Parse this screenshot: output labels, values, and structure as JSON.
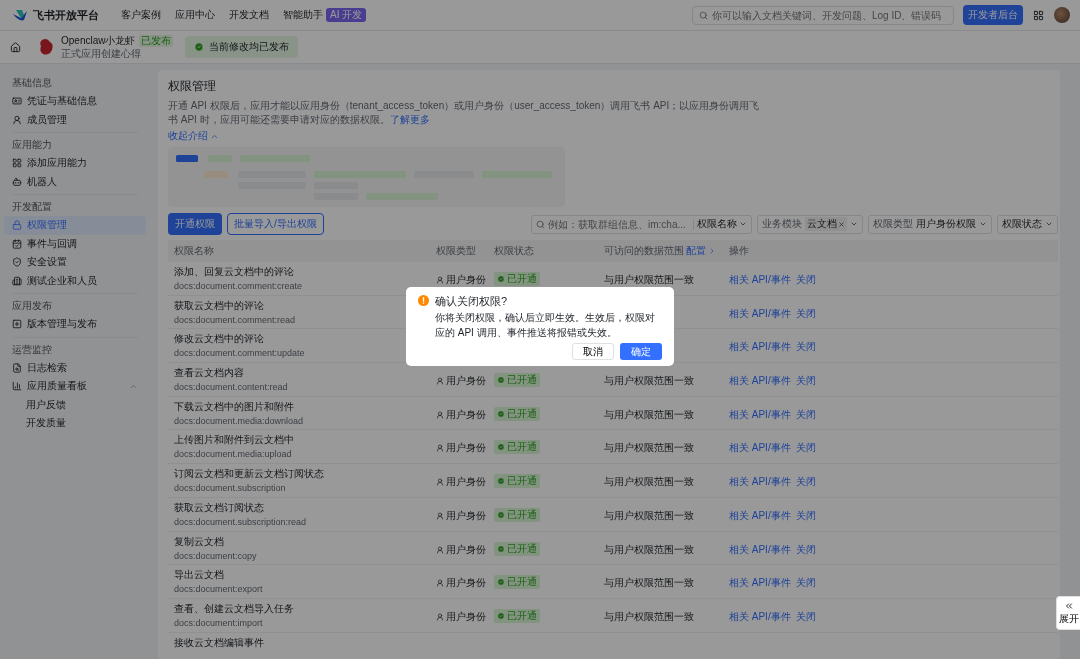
{
  "top_bar": {
    "brand": "飞书开放平台",
    "nav": [
      {
        "label": "客户案例"
      },
      {
        "label": "应用中心"
      },
      {
        "label": "开发文档"
      },
      {
        "label": "智能助手",
        "badge": "AI 开发"
      }
    ],
    "search": {
      "placeholder": "你可以输入文档关键词、开发问题、Log ID、错误码"
    },
    "console_button": "开发者后台"
  },
  "app_bar": {
    "app_name": "Openclaw小龙虾",
    "app_status": "已发布",
    "app_subtitle": "正式应用创建心得",
    "notice": "当前修改均已发布"
  },
  "sidebar": [
    {
      "title": "基础信息",
      "items": [
        {
          "label": "凭证与基础信息",
          "selected": false
        },
        {
          "label": "成员管理",
          "selected": false
        }
      ]
    },
    {
      "title": "应用能力",
      "items": [
        {
          "label": "添加应用能力",
          "selected": false
        },
        {
          "label": "机器人",
          "selected": false
        }
      ]
    },
    {
      "title": "开发配置",
      "items": [
        {
          "label": "权限管理",
          "selected": true
        },
        {
          "label": "事件与回调",
          "selected": false
        },
        {
          "label": "安全设置",
          "selected": false
        },
        {
          "label": "测试企业和人员",
          "selected": false
        }
      ]
    },
    {
      "title": "应用发布",
      "items": [
        {
          "label": "版本管理与发布",
          "selected": false
        }
      ]
    },
    {
      "title": "运营监控",
      "items": [
        {
          "label": "日志检索",
          "selected": false
        },
        {
          "label": "应用质量看板",
          "selected": false,
          "expanded": true,
          "children": [
            {
              "label": "用户反馈",
              "selected": false
            },
            {
              "label": "开发质量",
              "selected": false
            }
          ]
        }
      ]
    }
  ],
  "page": {
    "title": "权限管理",
    "intro": "开通 API 权限后，应用才能以应用身份（tenant_access_token）或用户身份（user_access_token）调用飞书 API；以应用身份调用飞书 API 时，应用可能还需要申请对应的数据权限。",
    "learn_more": "了解更多",
    "collapse": "收起介绍",
    "primary_button": "开通权限",
    "secondary_button": "批量导入/导出权限",
    "filters": {
      "search_placeholder": "例如：获取群组信息、im:cha...",
      "name_filter": "权限名称",
      "module_label": "业务模块",
      "module_value": "云文档",
      "type_label": "权限类型",
      "type_value": "用户身份权限",
      "status_label": "权限状态"
    }
  },
  "table": {
    "columns": [
      "权限名称",
      "权限类型",
      "权限状态",
      "可访问的数据范围",
      "操作"
    ],
    "config_link": "配置",
    "rows": [
      {
        "name": "添加、回复云文档中的评论",
        "scope": "docs:document.comment:create",
        "type": "用户身份",
        "status": "已开通",
        "range": "与用户权限范围一致",
        "actions": [
          "相关 API/事件",
          "关闭"
        ]
      },
      {
        "name": "获取云文档中的评论",
        "scope": "docs:document.comment:read",
        "actions": [
          "相关 API/事件",
          "关闭"
        ]
      },
      {
        "name": "修改云文档中的评论",
        "scope": "docs:document.comment:update",
        "actions": [
          "相关 API/事件",
          "关闭"
        ]
      },
      {
        "name": "查看云文档内容",
        "scope": "docs:document.content:read",
        "type": "用户身份",
        "status": "已开通",
        "range": "与用户权限范围一致",
        "actions": [
          "相关 API/事件",
          "关闭"
        ]
      },
      {
        "name": "下载云文档中的图片和附件",
        "scope": "docs:document.media:download",
        "type": "用户身份",
        "status": "已开通",
        "range": "与用户权限范围一致",
        "actions": [
          "相关 API/事件",
          "关闭"
        ]
      },
      {
        "name": "上传图片和附件到云文档中",
        "scope": "docs:document.media:upload",
        "type": "用户身份",
        "status": "已开通",
        "range": "与用户权限范围一致",
        "actions": [
          "相关 API/事件",
          "关闭"
        ]
      },
      {
        "name": "订阅云文档和更新云文档订阅状态",
        "scope": "docs:document.subscription",
        "type": "用户身份",
        "status": "已开通",
        "range": "与用户权限范围一致",
        "actions": [
          "相关 API/事件",
          "关闭"
        ]
      },
      {
        "name": "获取云文档订阅状态",
        "scope": "docs:document.subscription:read",
        "type": "用户身份",
        "status": "已开通",
        "range": "与用户权限范围一致",
        "actions": [
          "相关 API/事件",
          "关闭"
        ]
      },
      {
        "name": "复制云文档",
        "scope": "docs:document:copy",
        "type": "用户身份",
        "status": "已开通",
        "range": "与用户权限范围一致",
        "actions": [
          "相关 API/事件",
          "关闭"
        ]
      },
      {
        "name": "导出云文档",
        "scope": "docs:document:export",
        "type": "用户身份",
        "status": "已开通",
        "range": "与用户权限范围一致",
        "actions": [
          "相关 API/事件",
          "关闭"
        ]
      },
      {
        "name": "查看、创建云文档导入任务",
        "scope": "docs:document:import",
        "type": "用户身份",
        "status": "已开通",
        "range": "与用户权限范围一致",
        "actions": [
          "相关 API/事件",
          "关闭"
        ]
      },
      {
        "name": "接收云文档编辑事件"
      }
    ]
  },
  "dialog": {
    "title": "确认关闭权限?",
    "message": "你将关闭权限，确认后立即生效。生效后，权限对应的 API 调用、事件推送将报错或失效。",
    "cancel": "取消",
    "confirm": "确定"
  },
  "expand_button": "展开"
}
